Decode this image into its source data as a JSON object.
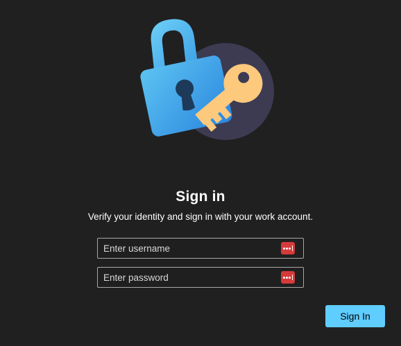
{
  "dialog": {
    "title": "Sign in",
    "subtitle": "Verify your identity and sign in with your work account.",
    "illustration": "lock-and-key-icon"
  },
  "fields": {
    "username": {
      "placeholder": "Enter username",
      "value": "",
      "icon": "password-manager-icon"
    },
    "password": {
      "placeholder": "Enter password",
      "value": "",
      "icon": "password-manager-icon"
    }
  },
  "actions": {
    "signin_label": "Sign In"
  },
  "colors": {
    "background": "#202020",
    "accent": "#60cdff",
    "field_border": "#a8a8a8",
    "password_manager": "#d63a3a",
    "lock_blue": "#3aa0e6",
    "key_yellow": "#fcc97d",
    "circle": "#3c3b52"
  }
}
